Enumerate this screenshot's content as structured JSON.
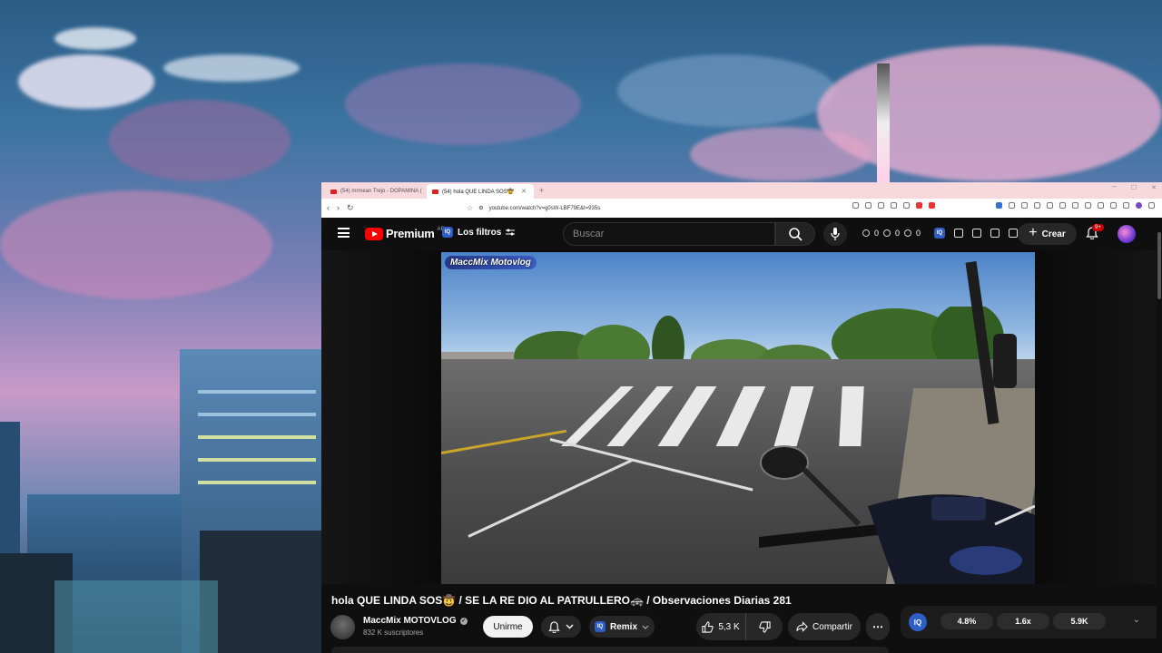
{
  "browser": {
    "tabs": [
      {
        "label": "(54) mrmean Trejo - DOPAMINA ("
      },
      {
        "label": "(54) hola QUE LINDA SOS🤠"
      }
    ],
    "new_tab": "+",
    "url": "youtube.com/watch?v=g0sW-LBF79E&t=935s"
  },
  "youtube": {
    "logo": "Premium",
    "country": "AR",
    "filters_label": "Los filtros",
    "search_placeholder": "Buscar",
    "stat_counts": [
      "0",
      "0",
      "0"
    ],
    "create_label": "Crear",
    "notif_badge": "9+",
    "watermark": "MaccMix Motovlog"
  },
  "video": {
    "title": "hola QUE LINDA SOS🤠 / SE LA RE DIO AL PATRULLERO🚓 / Observaciones Diarias 281",
    "channel_name": "MaccMix MOTOVLOG",
    "subscribers": "832 K suscriptores",
    "join_label": "Unirme",
    "remix_label": "Remix",
    "likes": "5,3 K",
    "share_label": "Compartir",
    "more": "⋯"
  },
  "stats_panel": {
    "iq": "IQ",
    "pills": [
      "4.8%",
      "1.6x",
      "5.9K"
    ]
  },
  "colors": {
    "yt_red": "#ff0000",
    "iq_blue": "#2f5ec9",
    "tab_bar": "#f7d8dd"
  }
}
